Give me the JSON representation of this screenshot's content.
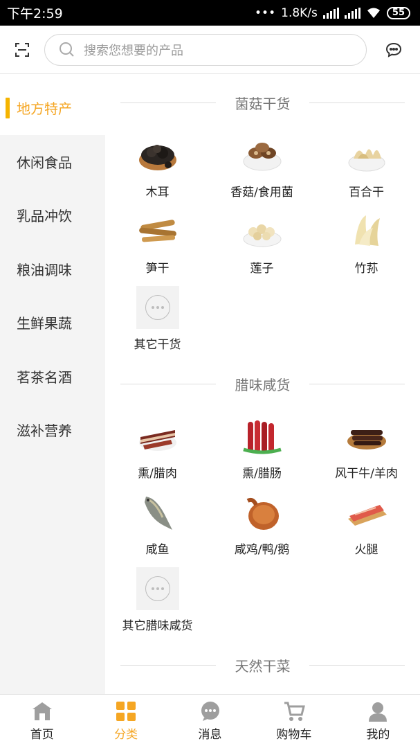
{
  "status_bar": {
    "time": "下午2:59",
    "network_speed": "1.8K/s",
    "battery": "55"
  },
  "search": {
    "placeholder": "搜索您想要的产品"
  },
  "sidebar": {
    "items": [
      {
        "label": "地方特产",
        "active": true
      },
      {
        "label": "休闲食品",
        "active": false
      },
      {
        "label": "乳品冲饮",
        "active": false
      },
      {
        "label": "粮油调味",
        "active": false
      },
      {
        "label": "生鲜果蔬",
        "active": false
      },
      {
        "label": "茗茶名酒",
        "active": false
      },
      {
        "label": "滋补营养",
        "active": false
      }
    ]
  },
  "sections": [
    {
      "title": "菌菇干货",
      "items": [
        {
          "label": "木耳",
          "icon": "wood-ear-fungus-image"
        },
        {
          "label": "香菇/食用菌",
          "icon": "shiitake-mushroom-image"
        },
        {
          "label": "百合干",
          "icon": "dried-lily-image"
        },
        {
          "label": "笋干",
          "icon": "dried-bamboo-shoot-image"
        },
        {
          "label": "莲子",
          "icon": "lotus-seed-image"
        },
        {
          "label": "竹荪",
          "icon": "bamboo-fungus-image"
        },
        {
          "label": "其它干货",
          "icon": "more-icon"
        }
      ]
    },
    {
      "title": "腊味咸货",
      "items": [
        {
          "label": "熏/腊肉",
          "icon": "cured-pork-image"
        },
        {
          "label": "熏/腊肠",
          "icon": "sausage-image"
        },
        {
          "label": "风干牛/羊肉",
          "icon": "dried-beef-image"
        },
        {
          "label": "咸鱼",
          "icon": "salted-fish-image"
        },
        {
          "label": "咸鸡/鸭/鹅",
          "icon": "salted-duck-image"
        },
        {
          "label": "火腿",
          "icon": "ham-image"
        },
        {
          "label": "其它腊味咸货",
          "icon": "more-icon"
        }
      ]
    },
    {
      "title": "天然干菜",
      "items": []
    }
  ],
  "bottom_nav": {
    "items": [
      {
        "label": "首页",
        "icon": "home-icon",
        "active": false
      },
      {
        "label": "分类",
        "icon": "category-grid-icon",
        "active": true
      },
      {
        "label": "消息",
        "icon": "message-icon",
        "active": false
      },
      {
        "label": "购物车",
        "icon": "cart-icon",
        "active": false
      },
      {
        "label": "我的",
        "icon": "profile-icon",
        "active": false
      }
    ]
  },
  "colors": {
    "accent": "#f5a623",
    "sidebar_bg": "#f4f4f4",
    "status_bar_bg": "#000000"
  }
}
